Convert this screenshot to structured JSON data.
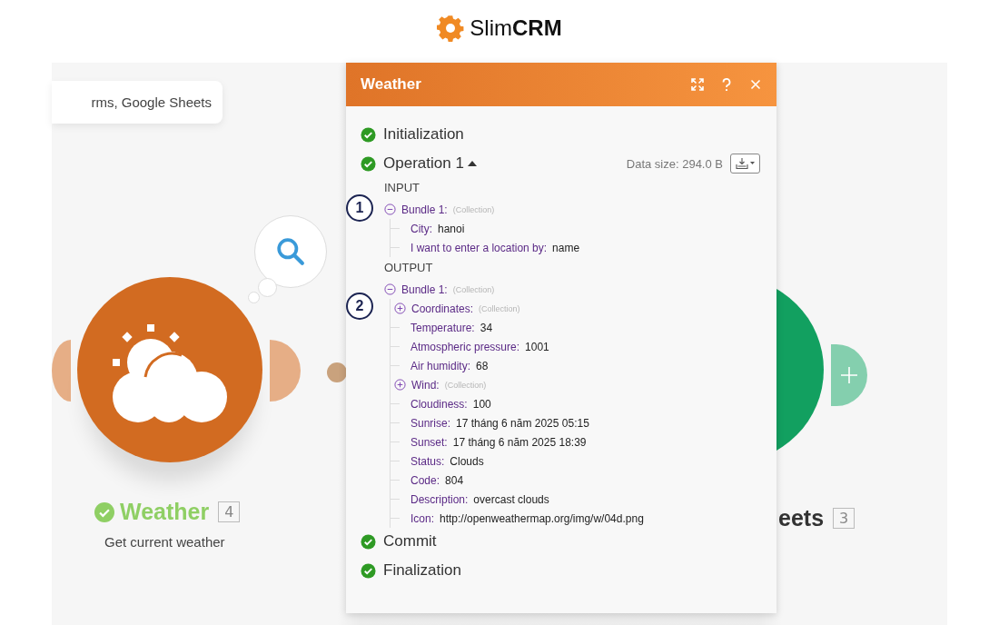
{
  "logo": {
    "text": "Slim**CRM**"
  },
  "canvas": {
    "tooltip": "rms, Google Sheets",
    "modules": [
      {
        "kind": "weather",
        "name": "Weather",
        "count": "4",
        "subtitle": "Get current weather",
        "success": true
      },
      {
        "kind": "sheets",
        "name": "eets",
        "count": "3"
      }
    ]
  },
  "panel": {
    "title": "Weather",
    "stages": [
      {
        "label": "Initialization",
        "success": true
      },
      {
        "label": "Operation 1",
        "success": true,
        "expanded": true,
        "data_size": "Data size: 294.0 B",
        "sections": [
          {
            "heading": "INPUT",
            "callout": "1",
            "bundles": [
              {
                "key": "Bundle 1:",
                "type": "(Collection)",
                "expanded": true,
                "children": [
                  {
                    "key": "City:",
                    "value": "hanoi"
                  },
                  {
                    "key": "I want to enter a location by:",
                    "value": "name"
                  }
                ]
              }
            ]
          },
          {
            "heading": "OUTPUT",
            "callout": "2",
            "bundles": [
              {
                "key": "Bundle 1:",
                "type": "(Collection)",
                "expanded": true,
                "children": [
                  {
                    "key": "Coordinates:",
                    "type": "(Collection)",
                    "expanded": false
                  },
                  {
                    "key": "Temperature:",
                    "value": "34"
                  },
                  {
                    "key": "Atmospheric pressure:",
                    "value": "1001"
                  },
                  {
                    "key": "Air humidity:",
                    "value": "68"
                  },
                  {
                    "key": "Wind:",
                    "type": "(Collection)",
                    "expanded": false
                  },
                  {
                    "key": "Cloudiness:",
                    "value": "100"
                  },
                  {
                    "key": "Sunrise:",
                    "value": "17 tháng 6 năm 2025 05:15"
                  },
                  {
                    "key": "Sunset:",
                    "value": "17 tháng 6 năm 2025 18:39"
                  },
                  {
                    "key": "Status:",
                    "value": "Clouds"
                  },
                  {
                    "key": "Code:",
                    "value": "804"
                  },
                  {
                    "key": "Description:",
                    "value": "overcast clouds"
                  },
                  {
                    "key": "Icon:",
                    "value": "http://openweathermap.org/img/w/04d.png"
                  }
                ]
              }
            ]
          }
        ]
      },
      {
        "label": "Commit",
        "success": true
      },
      {
        "label": "Finalization",
        "success": true
      }
    ]
  }
}
